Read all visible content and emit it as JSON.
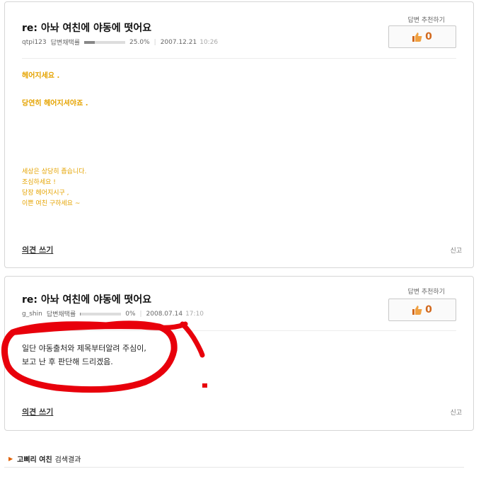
{
  "answers": [
    {
      "title": "re: 아놔 여친에 야동에 떳어요",
      "user": "qtpi123",
      "rate_label": "답변채택률",
      "rate_value": "25.0%",
      "rate_fraction": 0.25,
      "date": "2007.12.21",
      "time": "10:26",
      "recommend_label": "답변 추천하기",
      "recommend_count": "0",
      "body_bold": [
        "헤어지세요 .",
        "당연히 헤어지셔야죠 ."
      ],
      "body_small": [
        "세상은 상당히 좁습니다.",
        "조심하세요 !",
        "당장 헤어지시구 ,",
        "이쁜 여친 구하세요 ~"
      ],
      "opinion_label": "의견 쓰기",
      "report_label": "신고"
    },
    {
      "title": "re: 아놔 여친에 야동에 떳어요",
      "user": "g_shin",
      "rate_label": "답변채택률",
      "rate_value": "0%",
      "rate_fraction": 0.02,
      "date": "2008.07.14",
      "time": "17:10",
      "recommend_label": "답변 추천하기",
      "recommend_count": "0",
      "body": [
        "일단 야동출처와 제목부터알려 주심이,",
        "보고 난 후 판단해 드리겠음."
      ],
      "opinion_label": "의견 쓰기",
      "report_label": "신고"
    }
  ],
  "search": {
    "keyword": "고삐리 여친",
    "suffix": "검색결과"
  },
  "colors": {
    "accent_yellow": "#e5a300",
    "count_orange": "#d2691e",
    "scribble_red": "#e8000b"
  },
  "icons": [
    "thumbs-up-icon",
    "arrow-right-icon"
  ]
}
